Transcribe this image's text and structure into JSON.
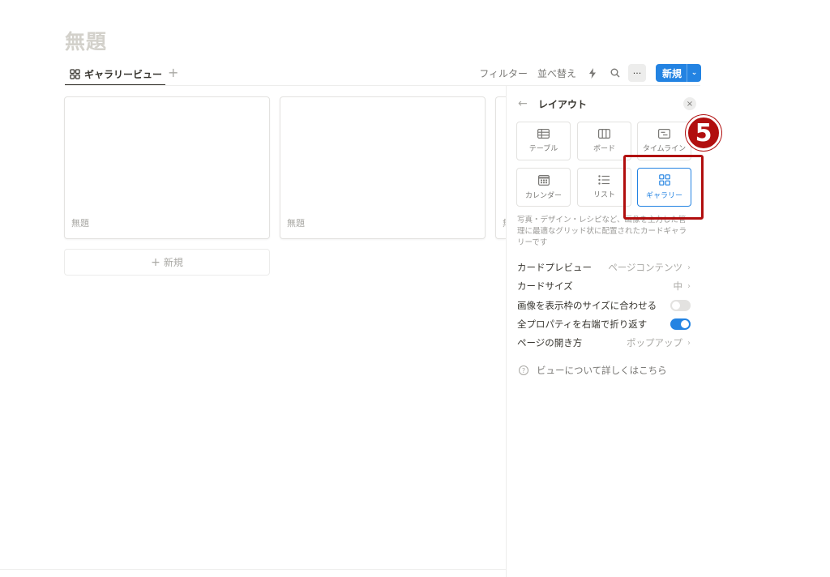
{
  "page": {
    "title": "無題"
  },
  "tabs": {
    "view_label": "ギャラリービュー",
    "add_symbol": "+"
  },
  "toolbar": {
    "filter": "フィルター",
    "sort": "並べ替え",
    "more_symbol": "···",
    "new_label": "新規",
    "new_arrow": "⌄"
  },
  "gallery": {
    "cards": [
      {
        "title": "無題"
      },
      {
        "title": "無題"
      },
      {
        "title": "無"
      }
    ],
    "new_card_label": "新規",
    "new_card_symbol": "+"
  },
  "panel": {
    "back_symbol": "←",
    "title": "レイアウト",
    "close_symbol": "×",
    "layouts": [
      {
        "label": "テーブル",
        "icon": "table-icon"
      },
      {
        "label": "ボード",
        "icon": "board-icon"
      },
      {
        "label": "タイムライン",
        "icon": "timeline-icon"
      },
      {
        "label": "カレンダー",
        "icon": "calendar-icon"
      },
      {
        "label": "リスト",
        "icon": "list-icon"
      },
      {
        "label": "ギャラリー",
        "icon": "gallery-icon",
        "selected": true
      }
    ],
    "description": "写真・デザイン・レシピなど、画像を主力した管理に最適なグリッド状に配置されたカードギャラリーです",
    "settings": {
      "card_preview": {
        "label": "カードプレビュー",
        "value": "ページコンテンツ"
      },
      "card_size": {
        "label": "カードサイズ",
        "value": "中"
      },
      "fit_image": {
        "label": "画像を表示枠のサイズに合わせる",
        "enabled": false
      },
      "wrap_props": {
        "label": "全プロパティを右端で折り返す",
        "enabled": true
      },
      "open_pages": {
        "label": "ページの開き方",
        "value": "ポップアップ"
      }
    },
    "chevron": "›",
    "help": {
      "symbol": "?",
      "label": "ビューについて詳しくはこちら"
    }
  },
  "annotation": {
    "number": "5"
  },
  "colors": {
    "accent": "#2383e2",
    "annotation": "#b10e0e"
  }
}
